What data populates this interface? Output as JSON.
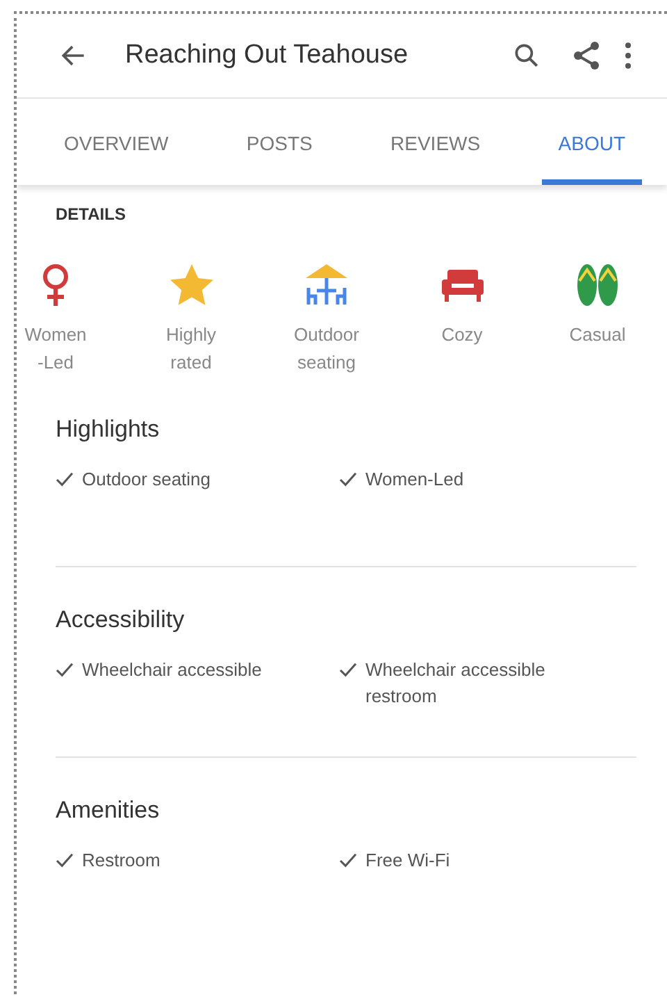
{
  "app_bar": {
    "title": "Reaching Out Teahouse"
  },
  "tabs": [
    {
      "label": "OVERVIEW",
      "selected": false
    },
    {
      "label": "POSTS",
      "selected": false
    },
    {
      "label": "REVIEWS",
      "selected": false
    },
    {
      "label": "ABOUT",
      "selected": true
    }
  ],
  "details": {
    "heading": "DETAILS",
    "attributes": [
      {
        "kind": "women",
        "label": "Women\n-Led"
      },
      {
        "kind": "star",
        "label": "Highly\nrated"
      },
      {
        "kind": "outdoor",
        "label": "Outdoor\nseating"
      },
      {
        "kind": "sofa",
        "label": "Cozy"
      },
      {
        "kind": "sandals",
        "label": "Casual"
      }
    ]
  },
  "sections": [
    {
      "title": "Highlights",
      "items": [
        "Outdoor seating",
        "Women-Led"
      ]
    },
    {
      "title": "Accessibility",
      "items": [
        "Wheelchair accessible",
        "Wheelchair accessible restroom"
      ]
    },
    {
      "title": "Amenities",
      "items": [
        "Restroom",
        "Free Wi-Fi"
      ]
    }
  ]
}
